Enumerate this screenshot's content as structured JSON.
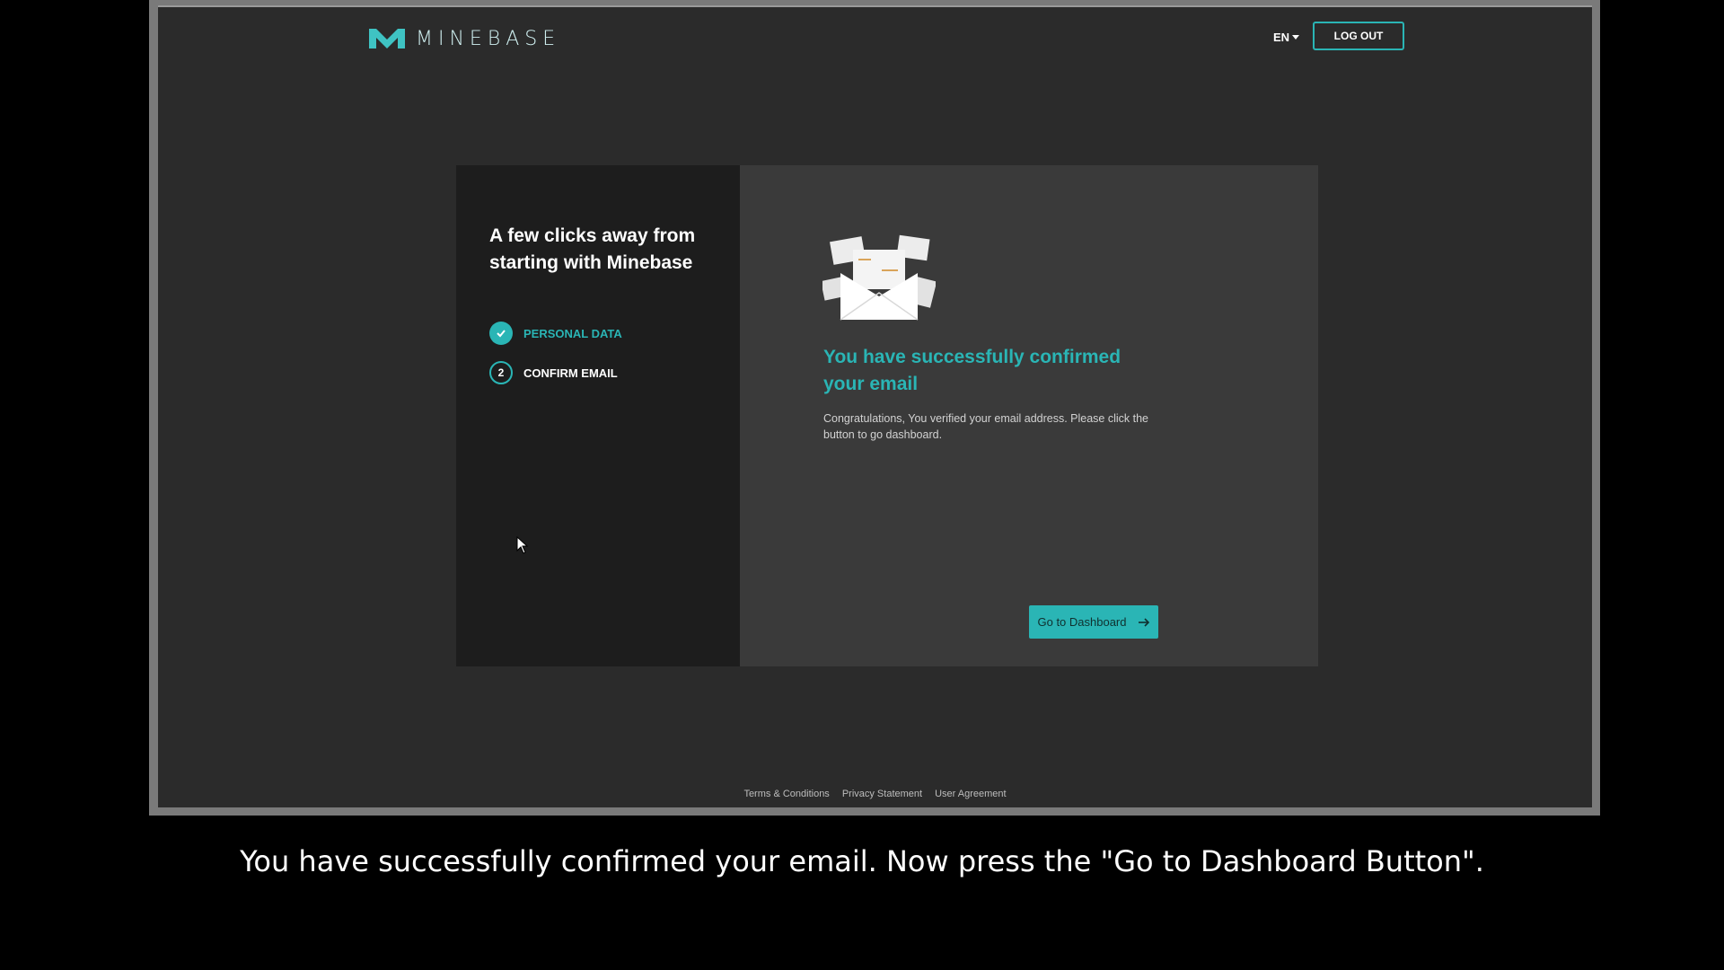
{
  "header": {
    "logo_text": "MINEBASE",
    "language": "EN",
    "logout_label": "LOG OUT"
  },
  "sidebar": {
    "title": "A few clicks away from starting with Minebase",
    "steps": [
      {
        "number": "",
        "label": "PERSONAL DATA",
        "state": "done"
      },
      {
        "number": "2",
        "label": "CONFIRM EMAIL",
        "state": "active"
      }
    ]
  },
  "main": {
    "success_title": "You have successfully confirmed your email",
    "success_text": "Congratulations, You verified your email address. Please click the button to go dashboard.",
    "dashboard_button": "Go to Dashboard"
  },
  "footer": {
    "links": [
      "Terms & Conditions",
      "Privacy Statement",
      "User Agreement"
    ]
  },
  "caption": "You have successfully confirmed your email. Now press the \"Go to Dashboard Button\".",
  "colors": {
    "accent": "#2ab5b5",
    "background": "#2b2b2b",
    "panel_dark": "#1d1d1d",
    "panel_light": "#3a3a3a"
  }
}
